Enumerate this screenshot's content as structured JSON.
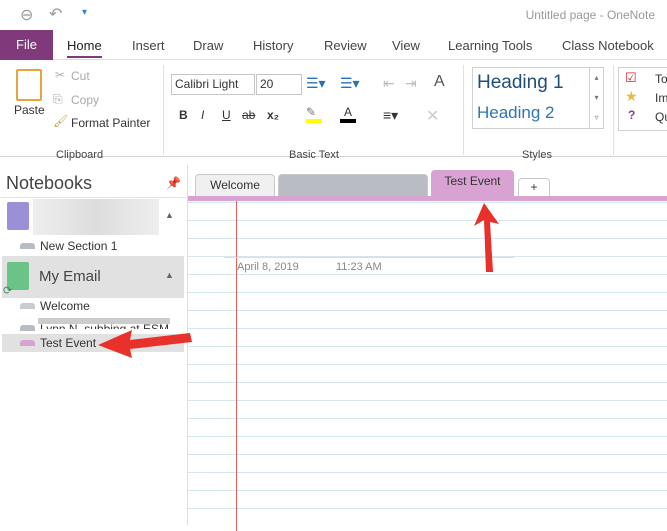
{
  "window": {
    "title": "Untitled page  -  OneNote"
  },
  "ribbon_tabs": [
    {
      "label": "File"
    },
    {
      "label": "Home"
    },
    {
      "label": "Insert"
    },
    {
      "label": "Draw"
    },
    {
      "label": "History"
    },
    {
      "label": "Review"
    },
    {
      "label": "View"
    },
    {
      "label": "Learning Tools"
    },
    {
      "label": "Class Notebook"
    }
  ],
  "clipboard": {
    "paste": "Paste",
    "cut": "Cut",
    "copy": "Copy",
    "format_painter": "Format Painter",
    "group": "Clipboard"
  },
  "basic_text": {
    "font": "Calibri Light",
    "size": "20",
    "group": "Basic Text",
    "bold": "B",
    "italic": "I",
    "underline": "U",
    "strike": "ab",
    "subscript": "x₂",
    "font_color": "A"
  },
  "styles": {
    "heading1": "Heading 1",
    "heading2": "Heading 2",
    "group": "Styles"
  },
  "tags": {
    "todo": "To",
    "important": "Im",
    "question": "Qu"
  },
  "notebooks": {
    "title": "Notebooks",
    "items": [
      {
        "name": "",
        "color": "#9b8fd6",
        "sections": [
          {
            "label": "New Section 1"
          }
        ]
      },
      {
        "name": "My Email",
        "color": "#6cc387",
        "sections": [
          {
            "label": "Welcome"
          },
          {
            "label": "Lynn N. subbing at ESM"
          },
          {
            "label": "Test Event",
            "color": "#d8a3d3"
          }
        ]
      }
    ]
  },
  "section_tabs": [
    {
      "label": "Welcome"
    },
    {
      "label": ""
    },
    {
      "label": "Test Event"
    },
    {
      "label": "+"
    }
  ],
  "page": {
    "date": "April 8, 2019",
    "time": "11:23 AM"
  },
  "colors": {
    "accent": "#80397b",
    "section": "#d8a3d3",
    "arrow": "#e8312b"
  }
}
